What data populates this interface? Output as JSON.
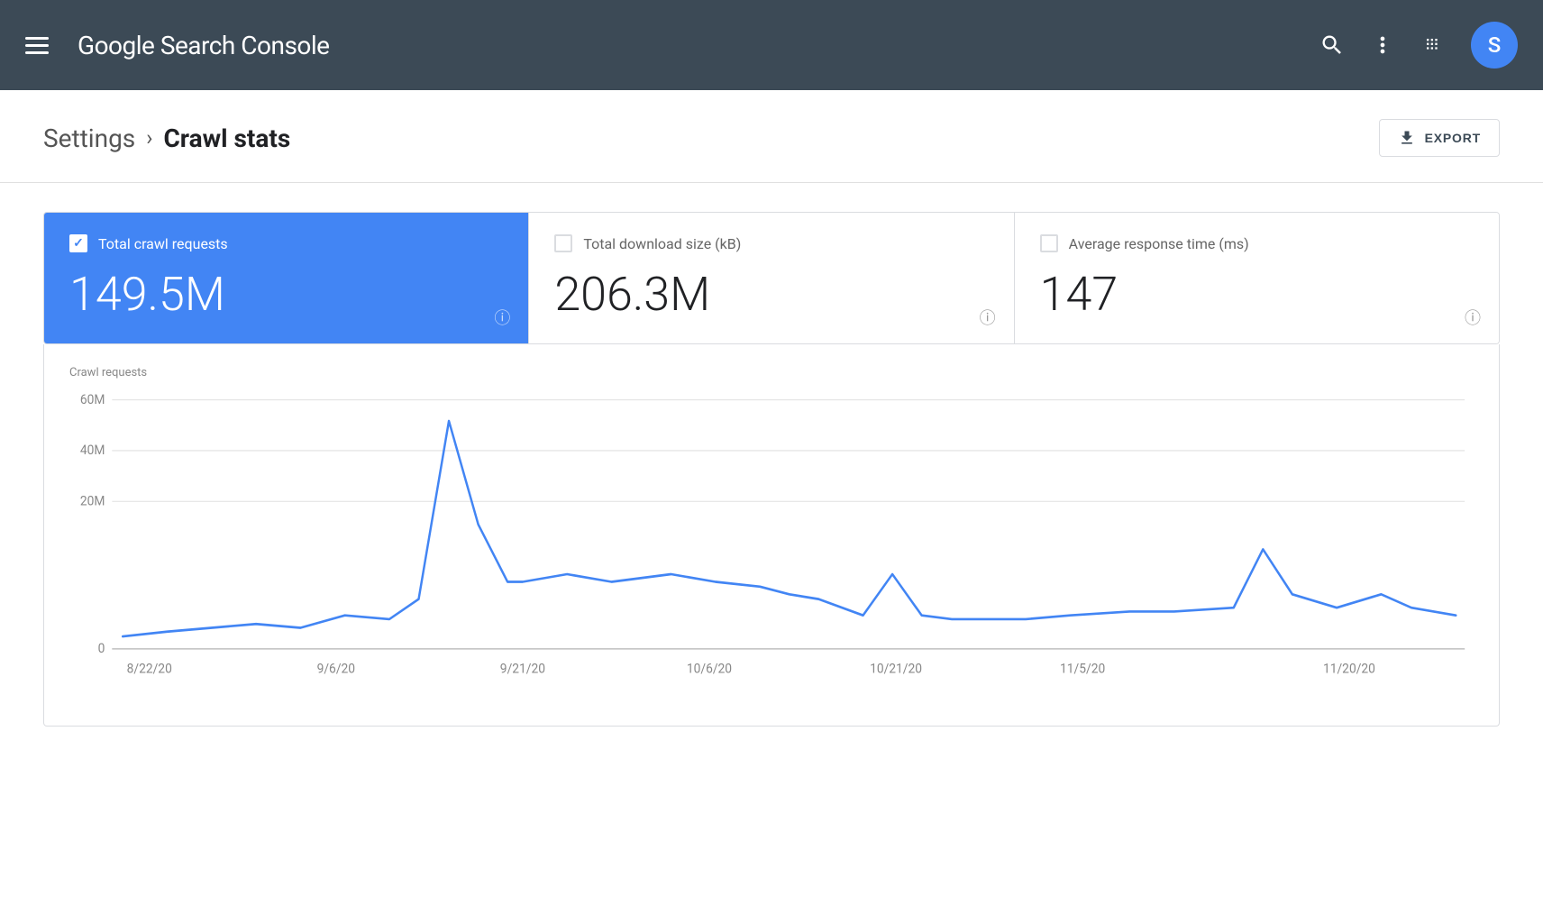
{
  "header": {
    "title": "Google Search Console",
    "title_google": "Google",
    "title_rest": " Search Console",
    "avatar_letter": "S"
  },
  "breadcrumb": {
    "settings_label": "Settings",
    "arrow": "›",
    "current_label": "Crawl stats"
  },
  "toolbar": {
    "export_label": "EXPORT"
  },
  "stats": [
    {
      "label": "Total crawl requests",
      "value": "149.5M",
      "active": true,
      "checkbox_checked": true
    },
    {
      "label": "Total download size (kB)",
      "value": "206.3M",
      "active": false,
      "checkbox_checked": false
    },
    {
      "label": "Average response time (ms)",
      "value": "147",
      "active": false,
      "checkbox_checked": false
    }
  ],
  "chart": {
    "y_label": "Crawl requests",
    "y_ticks": [
      "60M",
      "40M",
      "20M",
      "0"
    ],
    "x_ticks": [
      "8/22/20",
      "9/6/20",
      "9/21/20",
      "10/6/20",
      "10/21/20",
      "11/5/20",
      "11/20/20"
    ],
    "accent_color": "#4285f4",
    "grid_color": "#e0e0e0",
    "axis_color": "#999"
  }
}
